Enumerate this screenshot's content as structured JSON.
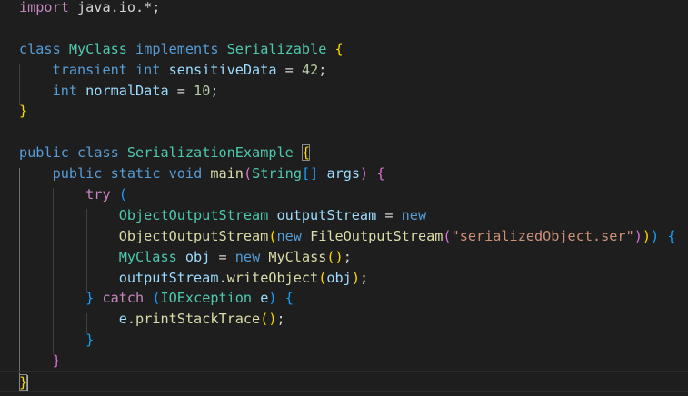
{
  "editor": {
    "lines": [
      [
        {
          "t": "import",
          "c": "kwc"
        },
        {
          "t": " java.io.*;",
          "c": "op"
        }
      ],
      [],
      [
        {
          "t": "class",
          "c": "kw"
        },
        {
          "t": " ",
          "c": "op"
        },
        {
          "t": "MyClass",
          "c": "type"
        },
        {
          "t": " ",
          "c": "op"
        },
        {
          "t": "implements",
          "c": "kw"
        },
        {
          "t": " ",
          "c": "op"
        },
        {
          "t": "Serializable",
          "c": "type"
        },
        {
          "t": " ",
          "c": "op"
        },
        {
          "t": "{",
          "c": "b1"
        }
      ],
      [
        {
          "t": "    ",
          "c": "op"
        },
        {
          "t": "transient",
          "c": "kw"
        },
        {
          "t": " ",
          "c": "op"
        },
        {
          "t": "int",
          "c": "kw"
        },
        {
          "t": " ",
          "c": "op"
        },
        {
          "t": "sensitiveData",
          "c": "var"
        },
        {
          "t": " = ",
          "c": "op"
        },
        {
          "t": "42",
          "c": "num"
        },
        {
          "t": ";",
          "c": "op"
        }
      ],
      [
        {
          "t": "    ",
          "c": "op"
        },
        {
          "t": "int",
          "c": "kw"
        },
        {
          "t": " ",
          "c": "op"
        },
        {
          "t": "normalData",
          "c": "var"
        },
        {
          "t": " = ",
          "c": "op"
        },
        {
          "t": "10",
          "c": "num"
        },
        {
          "t": ";",
          "c": "op"
        }
      ],
      [
        {
          "t": "}",
          "c": "b1"
        }
      ],
      [],
      [
        {
          "t": "public",
          "c": "kw"
        },
        {
          "t": " ",
          "c": "op"
        },
        {
          "t": "class",
          "c": "kw"
        },
        {
          "t": " ",
          "c": "op"
        },
        {
          "t": "SerializationExample",
          "c": "type"
        },
        {
          "t": " ",
          "c": "op"
        },
        {
          "t": "{",
          "c": "b1",
          "m": true
        }
      ],
      [
        {
          "t": "    ",
          "c": "op"
        },
        {
          "t": "public",
          "c": "kw"
        },
        {
          "t": " ",
          "c": "op"
        },
        {
          "t": "static",
          "c": "kw"
        },
        {
          "t": " ",
          "c": "op"
        },
        {
          "t": "void",
          "c": "kw"
        },
        {
          "t": " ",
          "c": "op"
        },
        {
          "t": "main",
          "c": "fn"
        },
        {
          "t": "(",
          "c": "b2"
        },
        {
          "t": "String",
          "c": "type"
        },
        {
          "t": "[]",
          "c": "b3"
        },
        {
          "t": " ",
          "c": "op"
        },
        {
          "t": "args",
          "c": "var"
        },
        {
          "t": ")",
          "c": "b2"
        },
        {
          "t": " ",
          "c": "op"
        },
        {
          "t": "{",
          "c": "b2"
        }
      ],
      [
        {
          "t": "        ",
          "c": "op"
        },
        {
          "t": "try",
          "c": "kwc"
        },
        {
          "t": " ",
          "c": "op"
        },
        {
          "t": "(",
          "c": "b3"
        }
      ],
      [
        {
          "t": "            ",
          "c": "op"
        },
        {
          "t": "ObjectOutputStream",
          "c": "type"
        },
        {
          "t": " ",
          "c": "op"
        },
        {
          "t": "outputStream",
          "c": "var"
        },
        {
          "t": " = ",
          "c": "op"
        },
        {
          "t": "new",
          "c": "kw"
        }
      ],
      [
        {
          "t": "            ",
          "c": "op"
        },
        {
          "t": "ObjectOutputStream",
          "c": "fn"
        },
        {
          "t": "(",
          "c": "b1"
        },
        {
          "t": "new",
          "c": "kw"
        },
        {
          "t": " ",
          "c": "op"
        },
        {
          "t": "FileOutputStream",
          "c": "fn"
        },
        {
          "t": "(",
          "c": "b2"
        },
        {
          "t": "\"serializedObject.ser\"",
          "c": "str"
        },
        {
          "t": ")",
          "c": "b2"
        },
        {
          "t": ")",
          "c": "b1"
        },
        {
          "t": ")",
          "c": "b3"
        },
        {
          "t": " ",
          "c": "op"
        },
        {
          "t": "{",
          "c": "b3"
        }
      ],
      [
        {
          "t": "            ",
          "c": "op"
        },
        {
          "t": "MyClass",
          "c": "type"
        },
        {
          "t": " ",
          "c": "op"
        },
        {
          "t": "obj",
          "c": "var"
        },
        {
          "t": " = ",
          "c": "op"
        },
        {
          "t": "new",
          "c": "kw"
        },
        {
          "t": " ",
          "c": "op"
        },
        {
          "t": "MyClass",
          "c": "fn"
        },
        {
          "t": "(",
          "c": "b1"
        },
        {
          "t": ")",
          "c": "b1"
        },
        {
          "t": ";",
          "c": "op"
        }
      ],
      [
        {
          "t": "            ",
          "c": "op"
        },
        {
          "t": "outputStream",
          "c": "var"
        },
        {
          "t": ".",
          "c": "op"
        },
        {
          "t": "writeObject",
          "c": "fn"
        },
        {
          "t": "(",
          "c": "b1"
        },
        {
          "t": "obj",
          "c": "var"
        },
        {
          "t": ")",
          "c": "b1"
        },
        {
          "t": ";",
          "c": "op"
        }
      ],
      [
        {
          "t": "        ",
          "c": "op"
        },
        {
          "t": "}",
          "c": "b3"
        },
        {
          "t": " ",
          "c": "op"
        },
        {
          "t": "catch",
          "c": "kwc"
        },
        {
          "t": " ",
          "c": "op"
        },
        {
          "t": "(",
          "c": "b3"
        },
        {
          "t": "IOException",
          "c": "type"
        },
        {
          "t": " ",
          "c": "op"
        },
        {
          "t": "e",
          "c": "var"
        },
        {
          "t": ")",
          "c": "b3"
        },
        {
          "t": " ",
          "c": "op"
        },
        {
          "t": "{",
          "c": "b3"
        }
      ],
      [
        {
          "t": "            ",
          "c": "op"
        },
        {
          "t": "e",
          "c": "var"
        },
        {
          "t": ".",
          "c": "op"
        },
        {
          "t": "printStackTrace",
          "c": "fn"
        },
        {
          "t": "(",
          "c": "b1"
        },
        {
          "t": ")",
          "c": "b1"
        },
        {
          "t": ";",
          "c": "op"
        }
      ],
      [
        {
          "t": "        ",
          "c": "op"
        },
        {
          "t": "}",
          "c": "b3"
        }
      ],
      [
        {
          "t": "    ",
          "c": "op"
        },
        {
          "t": "}",
          "c": "b2"
        }
      ],
      [
        {
          "t": "}",
          "c": "b1",
          "m": true,
          "cursor": true
        }
      ]
    ]
  }
}
